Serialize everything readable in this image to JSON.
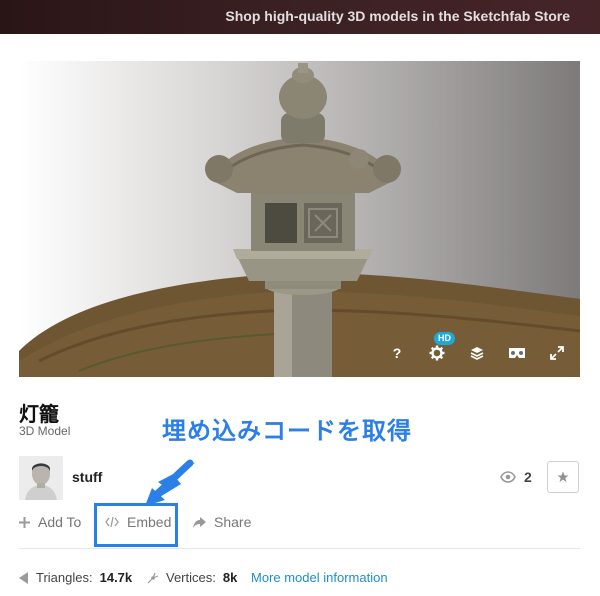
{
  "topbar": {
    "promo_text": "Shop high-quality 3D models in the Sketchfab Store"
  },
  "viewer": {
    "controls": [
      {
        "name": "help-icon",
        "label": "?"
      },
      {
        "name": "settings-icon",
        "badge": "HD"
      },
      {
        "name": "layers-icon"
      },
      {
        "name": "vr-icon"
      },
      {
        "name": "fullscreen-icon"
      }
    ],
    "hd_badge": "HD",
    "help_label": "?"
  },
  "model": {
    "title": "灯籠",
    "type": "3D Model"
  },
  "annotation": {
    "text": "埋め込みコードを取得"
  },
  "author": {
    "name": "stuff"
  },
  "stats_top": {
    "views": "2"
  },
  "actions": {
    "add_to": "Add To",
    "embed": "Embed",
    "share": "Share"
  },
  "stats": {
    "triangles_label": "Triangles:",
    "triangles_value": "14.7k",
    "vertices_label": "Vertices:",
    "vertices_value": "8k",
    "more_info": "More model information"
  },
  "colors": {
    "accent": "#2b7fe8",
    "link": "#1e8ec6",
    "hd_badge": "#1caad9",
    "topbar": "#3b2124"
  }
}
